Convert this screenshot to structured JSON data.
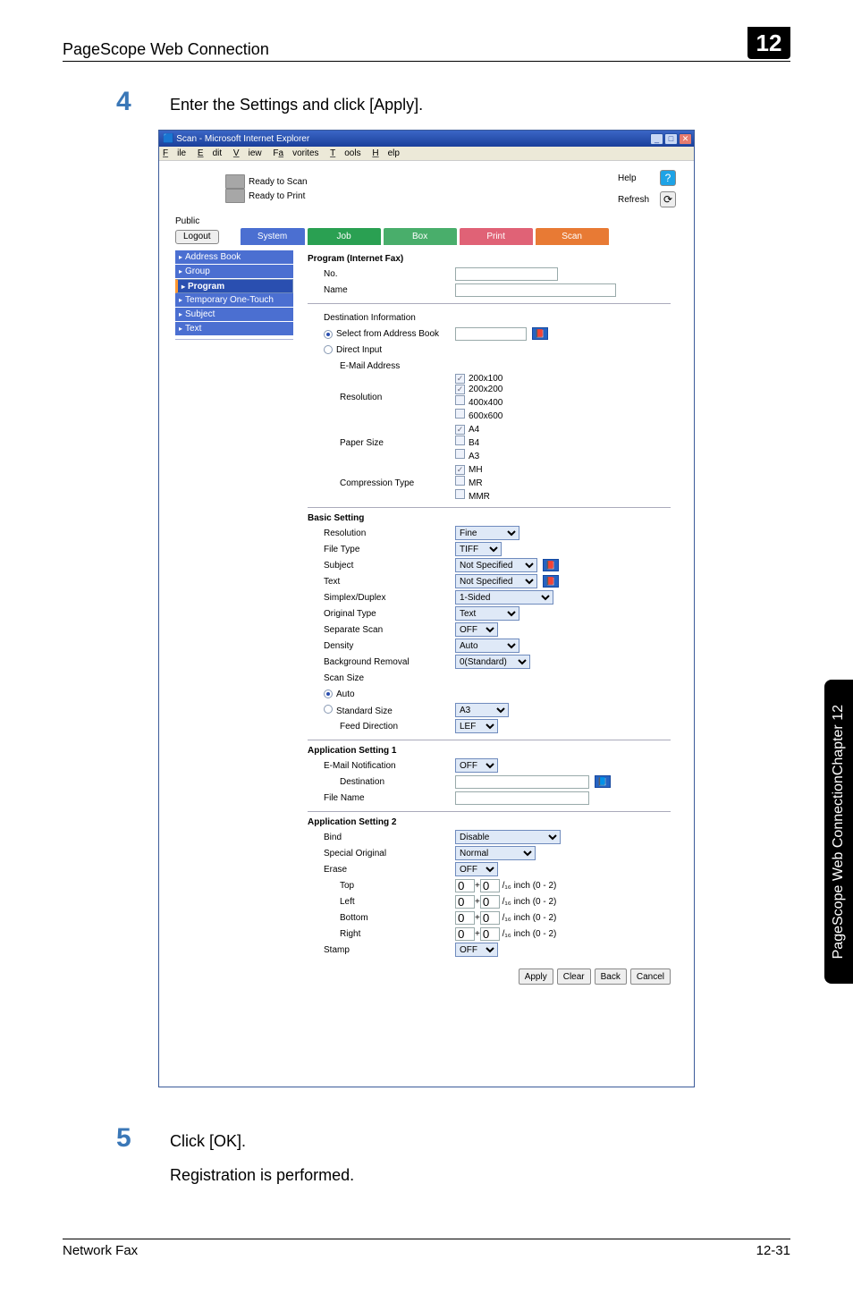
{
  "header": {
    "title": "PageScope Web Connection",
    "badge": "12"
  },
  "steps": {
    "s4": {
      "num": "4",
      "text": "Enter the Settings and click [Apply]."
    },
    "s5": {
      "num": "5",
      "text": "Click [OK].",
      "sub": "Registration is performed."
    }
  },
  "side_tab": {
    "prefix": "PageScope Web Connection",
    "suffix": "Chapter 12"
  },
  "footer": {
    "left": "Network Fax",
    "right": "12-31"
  },
  "win": {
    "title": "Scan - Microsoft Internet Explorer",
    "menu": {
      "file": "File",
      "edit": "Edit",
      "view": "View",
      "fav": "Favorites",
      "tools": "Tools",
      "help": "Help"
    },
    "status": {
      "scan": "Ready to Scan",
      "print": "Ready to Print"
    },
    "links": {
      "help": "Help",
      "refresh": "Refresh"
    },
    "public": "Public",
    "logout": "Logout",
    "tabs": {
      "system": "System",
      "job": "Job",
      "box": "Box",
      "print": "Print",
      "scan": "Scan"
    },
    "sidebar": {
      "addr": "Address Book",
      "group": "Group",
      "prog": "Program",
      "temp": "Temporary One-Touch",
      "subj": "Subject",
      "text": "Text"
    },
    "prog": {
      "heading": "Program (Internet Fax)",
      "no": "No.",
      "name": "Name",
      "dest_info": "Destination Information",
      "sel_ab": "Select from Address Book",
      "direct": "Direct Input",
      "email": "E-Mail Address",
      "resolution": "Resolution",
      "res_opts": {
        "a": "200x100",
        "b": "200x200",
        "c": "400x400",
        "d": "600x600"
      },
      "paper": "Paper Size",
      "paper_opts": {
        "a": "A4",
        "b": "B4",
        "c": "A3"
      },
      "comp": "Compression Type",
      "comp_opts": {
        "a": "MH",
        "b": "MR",
        "c": "MMR"
      }
    },
    "basic": {
      "heading": "Basic Setting",
      "resolution": {
        "lab": "Resolution",
        "val": "Fine"
      },
      "filetype": {
        "lab": "File Type",
        "val": "TIFF"
      },
      "subject": {
        "lab": "Subject",
        "val": "Not Specified"
      },
      "text": {
        "lab": "Text",
        "val": "Not Specified"
      },
      "simplex": {
        "lab": "Simplex/Duplex",
        "val": "1-Sided"
      },
      "origtype": {
        "lab": "Original Type",
        "val": "Text"
      },
      "sepscan": {
        "lab": "Separate Scan",
        "val": "OFF"
      },
      "density": {
        "lab": "Density",
        "val": "Auto"
      },
      "bgremove": {
        "lab": "Background Removal",
        "val": "0(Standard)"
      },
      "scansize": {
        "lab": "Scan Size",
        "auto": "Auto",
        "std": "Standard Size",
        "std_val": "A3"
      },
      "feeddir": {
        "lab": "Feed Direction",
        "val": "LEF"
      }
    },
    "app1": {
      "heading": "Application Setting 1",
      "email_notif": {
        "lab": "E-Mail Notification",
        "val": "OFF"
      },
      "dest": "Destination",
      "filename": "File Name"
    },
    "app2": {
      "heading": "Application Setting 2",
      "bind": {
        "lab": "Bind",
        "val": "Disable"
      },
      "special": {
        "lab": "Special Original",
        "val": "Normal"
      },
      "erase": {
        "lab": "Erase",
        "val": "OFF"
      },
      "margins": {
        "unit_pre": "/₁₆ inch (0 - 2)",
        "top": {
          "lab": "Top",
          "a": "0",
          "b": "0"
        },
        "left": {
          "lab": "Left",
          "a": "0",
          "b": "0"
        },
        "bottom": {
          "lab": "Bottom",
          "a": "0",
          "b": "0"
        },
        "right": {
          "lab": "Right",
          "a": "0",
          "b": "0"
        }
      },
      "stamp": {
        "lab": "Stamp",
        "val": "OFF"
      }
    },
    "buttons": {
      "apply": "Apply",
      "clear": "Clear",
      "back": "Back",
      "cancel": "Cancel"
    }
  }
}
